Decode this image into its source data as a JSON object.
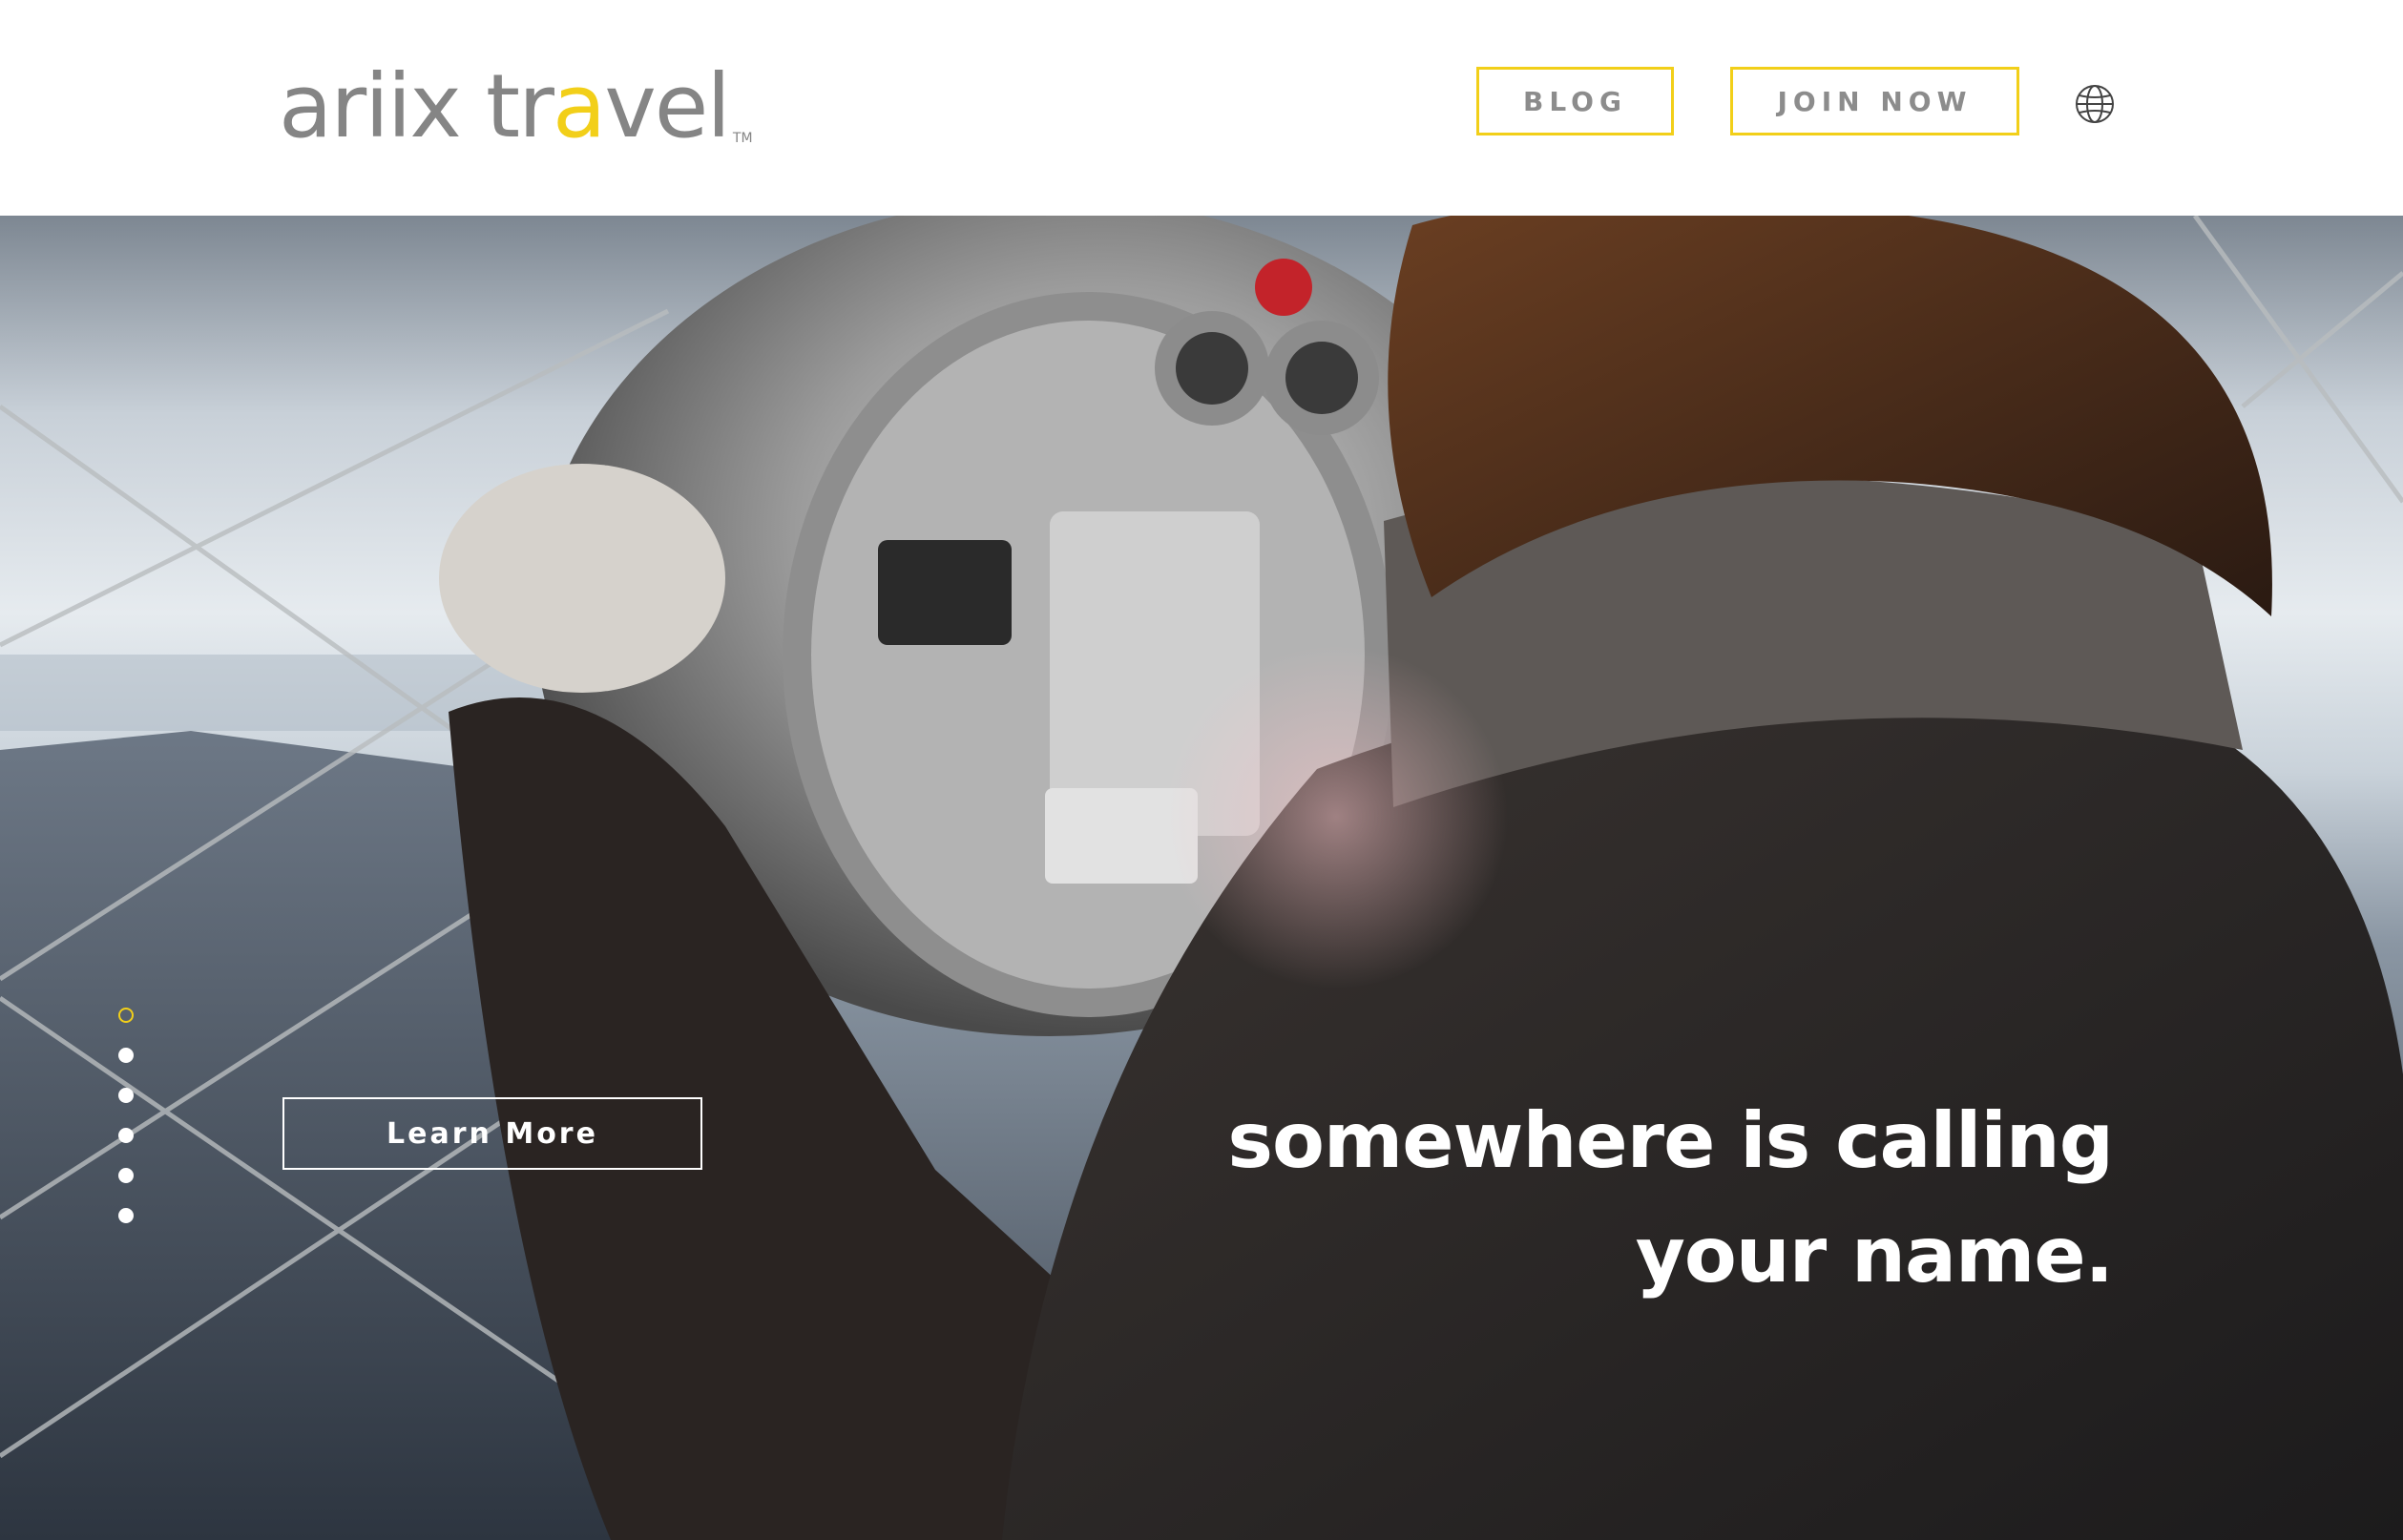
{
  "header": {
    "logo": {
      "part1": "ariix tr",
      "accent": "a",
      "part2": "vel",
      "tm": "TM"
    },
    "nav": {
      "blog_label": "BLOG",
      "join_label": "JOIN NOW"
    },
    "language_icon": "globe-icon"
  },
  "hero": {
    "slide_count": 6,
    "active_slide": 1,
    "learn_more_label": "Learn More",
    "tagline_line1": "somewhere is calling",
    "tagline_line2": "your name."
  },
  "colors": {
    "accent": "#f2cf19",
    "logo_gray": "#858585",
    "nav_text": "#8c8c8c"
  }
}
